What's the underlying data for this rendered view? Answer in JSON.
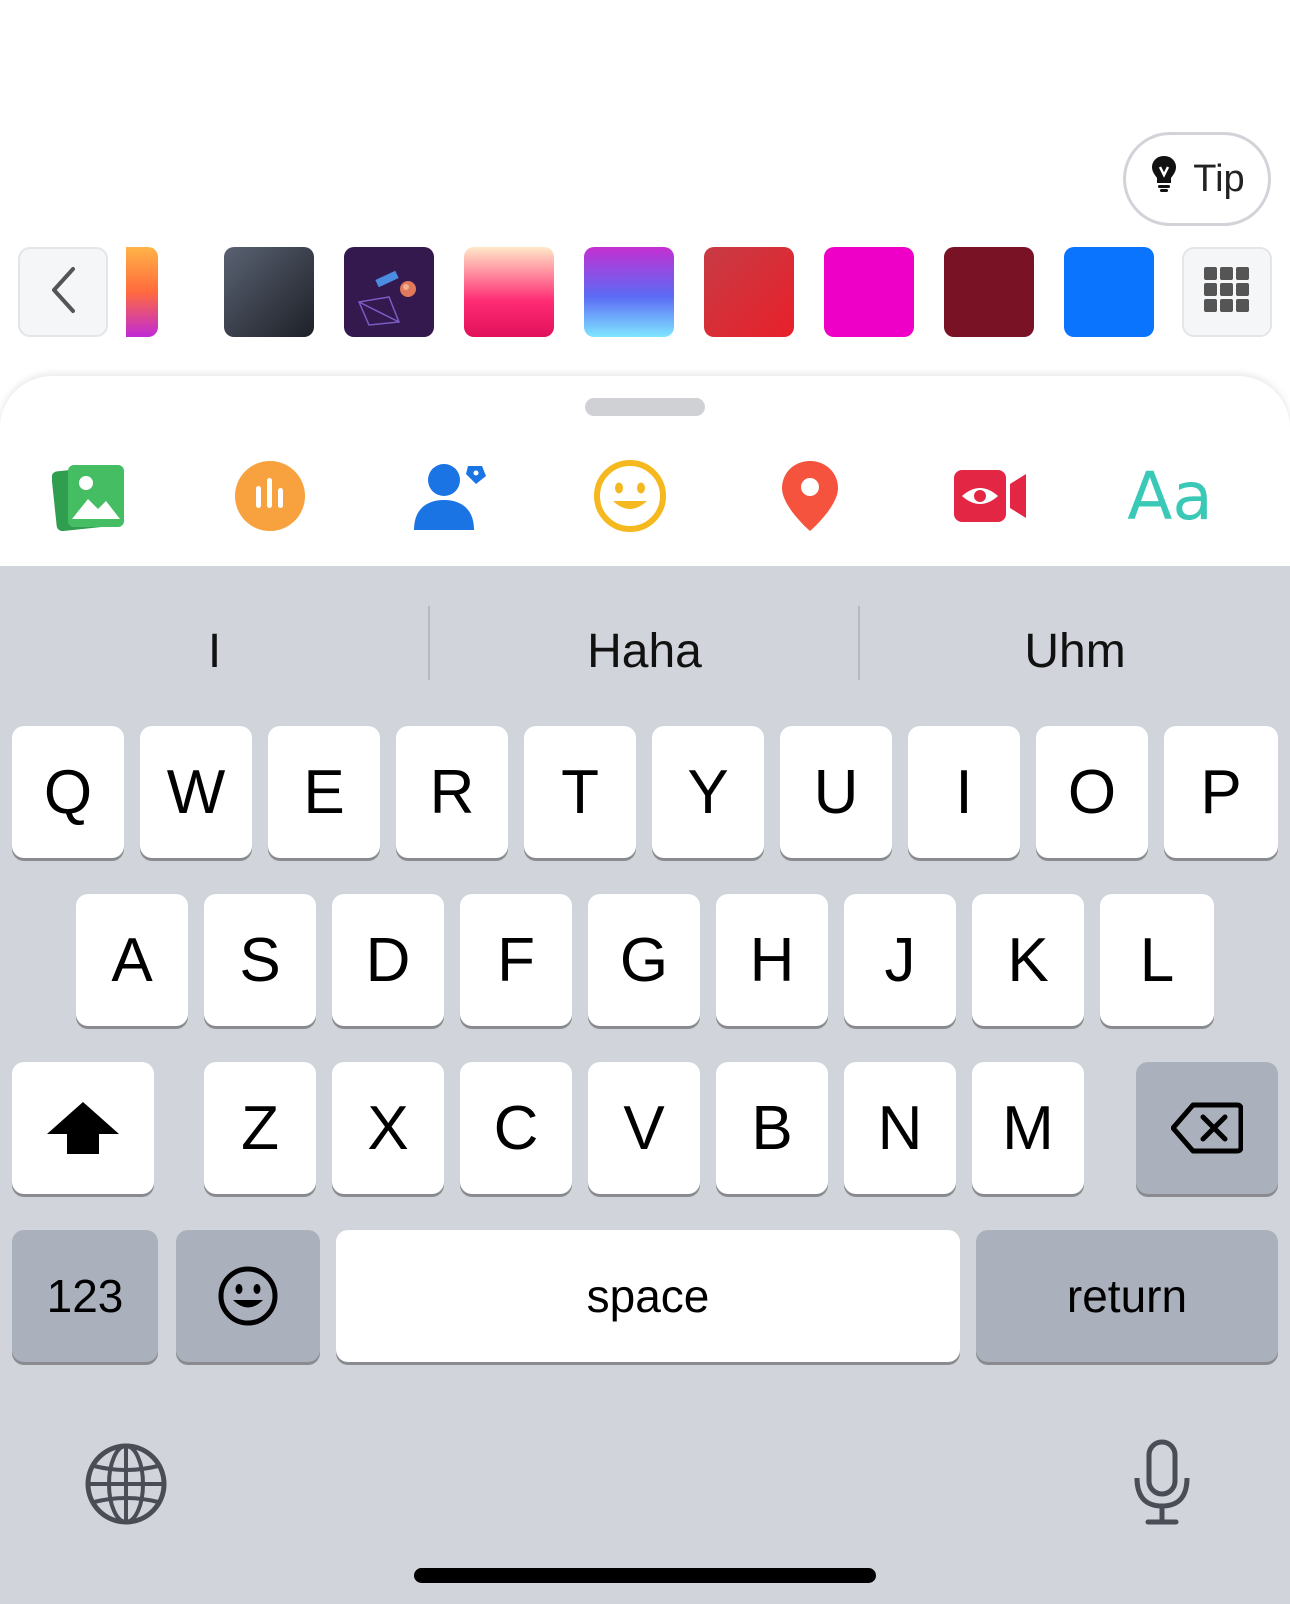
{
  "tip": {
    "label": "Tip",
    "icon": "lightbulb-icon"
  },
  "color_strip": {
    "prev_icon": "chevron-left-icon",
    "grid_icon": "grid-icon",
    "swatches": [
      {
        "name": "orange-purple-gradient",
        "colors": [
          "#ffb347",
          "#ff6a3d",
          "#c02bd6"
        ]
      },
      {
        "name": "dark-slate-gradient",
        "colors": [
          "#5a6272",
          "#1d2027"
        ]
      },
      {
        "name": "space-illustration",
        "colors": [
          "#3a1f55",
          "#2a1444"
        ]
      },
      {
        "name": "peach-pink-gradient",
        "colors": [
          "#ffe8c8",
          "#ff2c74",
          "#e0105a"
        ]
      },
      {
        "name": "purple-cyan-gradient",
        "colors": [
          "#c42fd1",
          "#5c6bf5",
          "#7fe6ff"
        ]
      },
      {
        "name": "red-gradient",
        "colors": [
          "#c73b44",
          "#e8202a"
        ]
      },
      {
        "name": "magenta",
        "colors": [
          "#ee00c7",
          "#ee00c7"
        ]
      },
      {
        "name": "maroon",
        "colors": [
          "#781224",
          "#781224"
        ]
      },
      {
        "name": "blue",
        "colors": [
          "#0a74ff",
          "#0a74ff"
        ]
      }
    ]
  },
  "toolbar": {
    "tools": [
      {
        "name": "photos-icon",
        "color": "#45bd62"
      },
      {
        "name": "poll-icon",
        "color": "#f7a23e"
      },
      {
        "name": "tag-people-icon",
        "color": "#1b74e4"
      },
      {
        "name": "feeling-icon",
        "color": "#f6b81f"
      },
      {
        "name": "location-icon",
        "color": "#f5533d"
      },
      {
        "name": "live-video-icon",
        "color": "#e42645"
      },
      {
        "name": "text-style-icon",
        "label": "Aa",
        "color": "#3bc9b7"
      }
    ]
  },
  "keyboard": {
    "suggestions": [
      "I",
      "Haha",
      "Uhm"
    ],
    "row1": [
      "Q",
      "W",
      "E",
      "R",
      "T",
      "Y",
      "U",
      "I",
      "O",
      "P"
    ],
    "row2": [
      "A",
      "S",
      "D",
      "F",
      "G",
      "H",
      "J",
      "K",
      "L"
    ],
    "row3": [
      "Z",
      "X",
      "C",
      "V",
      "B",
      "N",
      "M"
    ],
    "numbers_label": "123",
    "space_label": "space",
    "return_label": "return",
    "icons": {
      "shift": "shift-icon",
      "delete": "delete-icon",
      "emoji": "emoji-icon",
      "globe": "globe-icon",
      "mic": "microphone-icon"
    }
  }
}
